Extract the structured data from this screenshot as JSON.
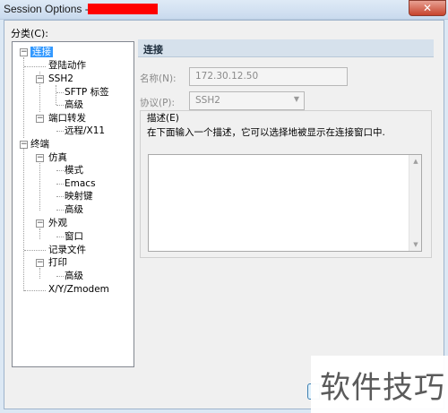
{
  "window": {
    "title": "Session Options -",
    "close_glyph": "✕"
  },
  "category": {
    "label": "分类(C):",
    "tree": [
      {
        "label": "连接",
        "expanded": true,
        "selected": true
      },
      {
        "label": "登陆动作"
      },
      {
        "label": "SSH2",
        "expanded": true
      },
      {
        "label": "SFTP 标签"
      },
      {
        "label": "高级"
      },
      {
        "label": "端口转发",
        "expanded": true
      },
      {
        "label": "远程/X11"
      },
      {
        "label": "终端",
        "expanded": true
      },
      {
        "label": "仿真",
        "expanded": true
      },
      {
        "label": "模式"
      },
      {
        "label": "Emacs"
      },
      {
        "label": "映射键"
      },
      {
        "label": "高级"
      },
      {
        "label": "外观",
        "expanded": true
      },
      {
        "label": "窗口"
      },
      {
        "label": "记录文件"
      },
      {
        "label": "打印",
        "expanded": true
      },
      {
        "label": "高级"
      },
      {
        "label": "X/Y/Zmodem"
      }
    ]
  },
  "panel": {
    "title": "连接",
    "name_label": "名称(N):",
    "name_value": "172.30.12.50",
    "protocol_label": "协议(P):",
    "protocol_value": "SSH2",
    "desc_group_title": "描述(E)",
    "desc_hint": "在下面输入一个描述，它可以选择地被显示在连接窗口中."
  },
  "watermark": "软件技巧",
  "colors": {
    "selection": "#3399ff",
    "title_redaction": "#ff0000",
    "close_button": "#c7432c"
  }
}
